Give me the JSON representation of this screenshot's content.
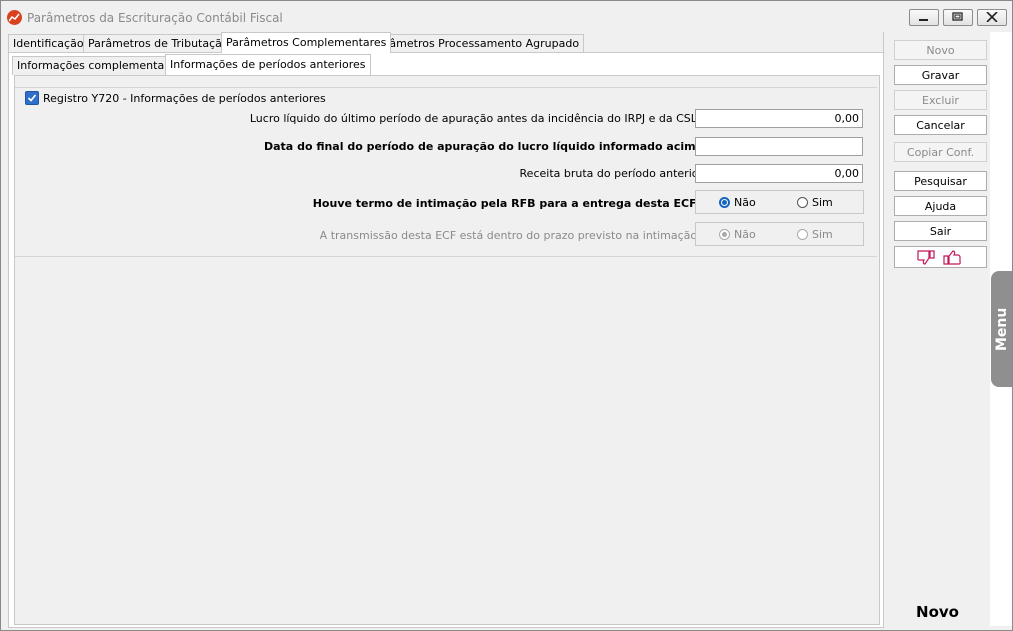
{
  "window": {
    "title": "Parâmetros da Escrituração Contábil Fiscal"
  },
  "tabs_top": [
    "Identificação",
    "Parâmetros de Tributação",
    "Parâmetros Complementares",
    "Parâmetros Processamento Agrupado"
  ],
  "tabs_sub": [
    "Informações complementares",
    "Informações de períodos anteriores"
  ],
  "group": {
    "checkbox_label": "Registro Y720 - Informações de períodos anteriores",
    "checked": true
  },
  "fields": {
    "lucro_label": "Lucro líquido do último período de apuração antes da incidência do IRPJ e da CSLL",
    "lucro_value": "0,00",
    "data_label": "Data do final do período de apuração do lucro líquido informado acima",
    "data_value": "",
    "receita_label": "Receita bruta do período anterior",
    "receita_value": "0,00",
    "intimacao_label": "Houve termo de intimação pela RFB para a entrega desta ECF?",
    "prazo_label": "A transmissão desta ECF está dentro do prazo previsto na intimação?",
    "opt_nao": "Não",
    "opt_sim": "Sim"
  },
  "sidebar": {
    "novo": "Novo",
    "gravar": "Gravar",
    "excluir": "Excluir",
    "cancelar": "Cancelar",
    "copiar": "Copiar Conf.",
    "pesquisar": "Pesquisar",
    "ajuda": "Ajuda",
    "sair": "Sair",
    "status": "Novo"
  },
  "menu_tab": "Menu",
  "colors": {
    "accent": "#1565c0",
    "app_icon": "#d9421f",
    "thumbs": "#c2185b"
  }
}
